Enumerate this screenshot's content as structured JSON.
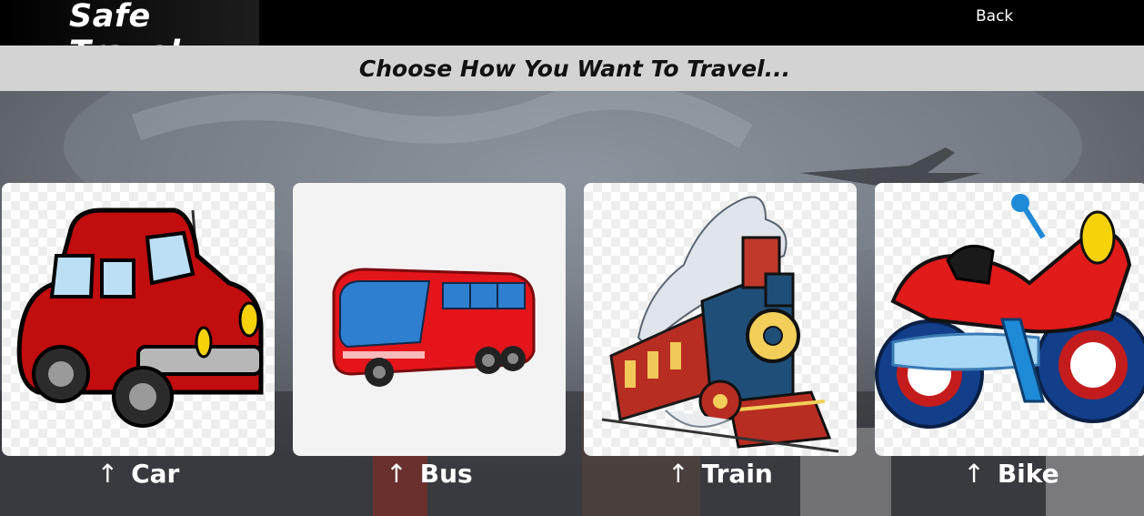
{
  "header": {
    "brand": "Safe Travel",
    "back_label": "Back"
  },
  "subheader": {
    "title": "Choose How You Want To Travel..."
  },
  "options": [
    {
      "label": "Car",
      "icon": "car-illustration"
    },
    {
      "label": "Bus",
      "icon": "bus-illustration"
    },
    {
      "label": "Train",
      "icon": "train-illustration"
    },
    {
      "label": "Bike",
      "icon": "motorbike-illustration"
    }
  ],
  "colors": {
    "topbar": "#000000",
    "subbar": "#d3d3d3",
    "label": "#ffffff"
  }
}
